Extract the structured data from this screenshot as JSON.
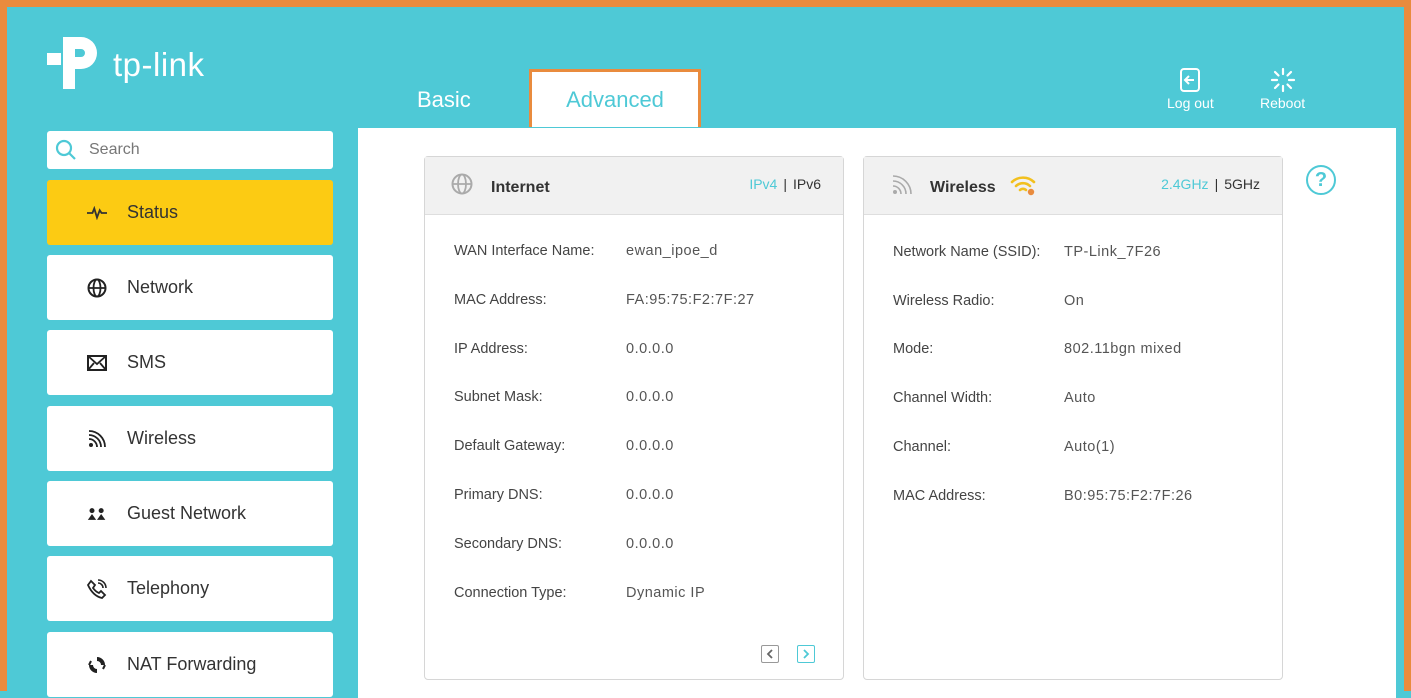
{
  "brand": {
    "name": "tp-link"
  },
  "tabs": {
    "basic": "Basic",
    "advanced": "Advanced"
  },
  "top_actions": {
    "logout": "Log out",
    "reboot": "Reboot"
  },
  "search": {
    "placeholder": "Search"
  },
  "sidebar": {
    "items": [
      {
        "label": "Status",
        "icon": "pulse-icon",
        "active": true
      },
      {
        "label": "Network",
        "icon": "globe-icon"
      },
      {
        "label": "SMS",
        "icon": "envelope-icon"
      },
      {
        "label": "Wireless",
        "icon": "wifi-signal-icon"
      },
      {
        "label": "Guest Network",
        "icon": "guests-icon"
      },
      {
        "label": "Telephony",
        "icon": "phone-icon"
      },
      {
        "label": "NAT Forwarding",
        "icon": "nat-icon"
      }
    ]
  },
  "internet": {
    "title": "Internet",
    "ipv4": "IPv4",
    "sep": "|",
    "ipv6": "IPv6",
    "rows": [
      {
        "label": "WAN Interface Name:",
        "value": "ewan_ipoe_d"
      },
      {
        "label": "MAC Address:",
        "value": "FA:95:75:F2:7F:27"
      },
      {
        "label": "IP Address:",
        "value": "0.0.0.0"
      },
      {
        "label": "Subnet Mask:",
        "value": "0.0.0.0"
      },
      {
        "label": "Default Gateway:",
        "value": "0.0.0.0"
      },
      {
        "label": "Primary DNS:",
        "value": "0.0.0.0"
      },
      {
        "label": "Secondary DNS:",
        "value": "0.0.0.0"
      },
      {
        "label": "Connection Type:",
        "value": "Dynamic IP"
      }
    ]
  },
  "wireless": {
    "title": "Wireless",
    "band24": "2.4GHz",
    "sep": "|",
    "band5": "5GHz",
    "rows": [
      {
        "label": "Network Name (SSID):",
        "value": "TP-Link_7F26"
      },
      {
        "label": "Wireless Radio:",
        "value": "On"
      },
      {
        "label": "Mode:",
        "value": "802.11bgn mixed"
      },
      {
        "label": "Channel Width:",
        "value": "Auto"
      },
      {
        "label": "Channel:",
        "value": "Auto(1)"
      },
      {
        "label": "MAC Address:",
        "value": "B0:95:75:F2:7F:26"
      }
    ]
  },
  "help": {
    "glyph": "?"
  },
  "colors": {
    "accent": "#4ec9d6",
    "active": "#fccb13",
    "highlight": "#e98b3e"
  }
}
